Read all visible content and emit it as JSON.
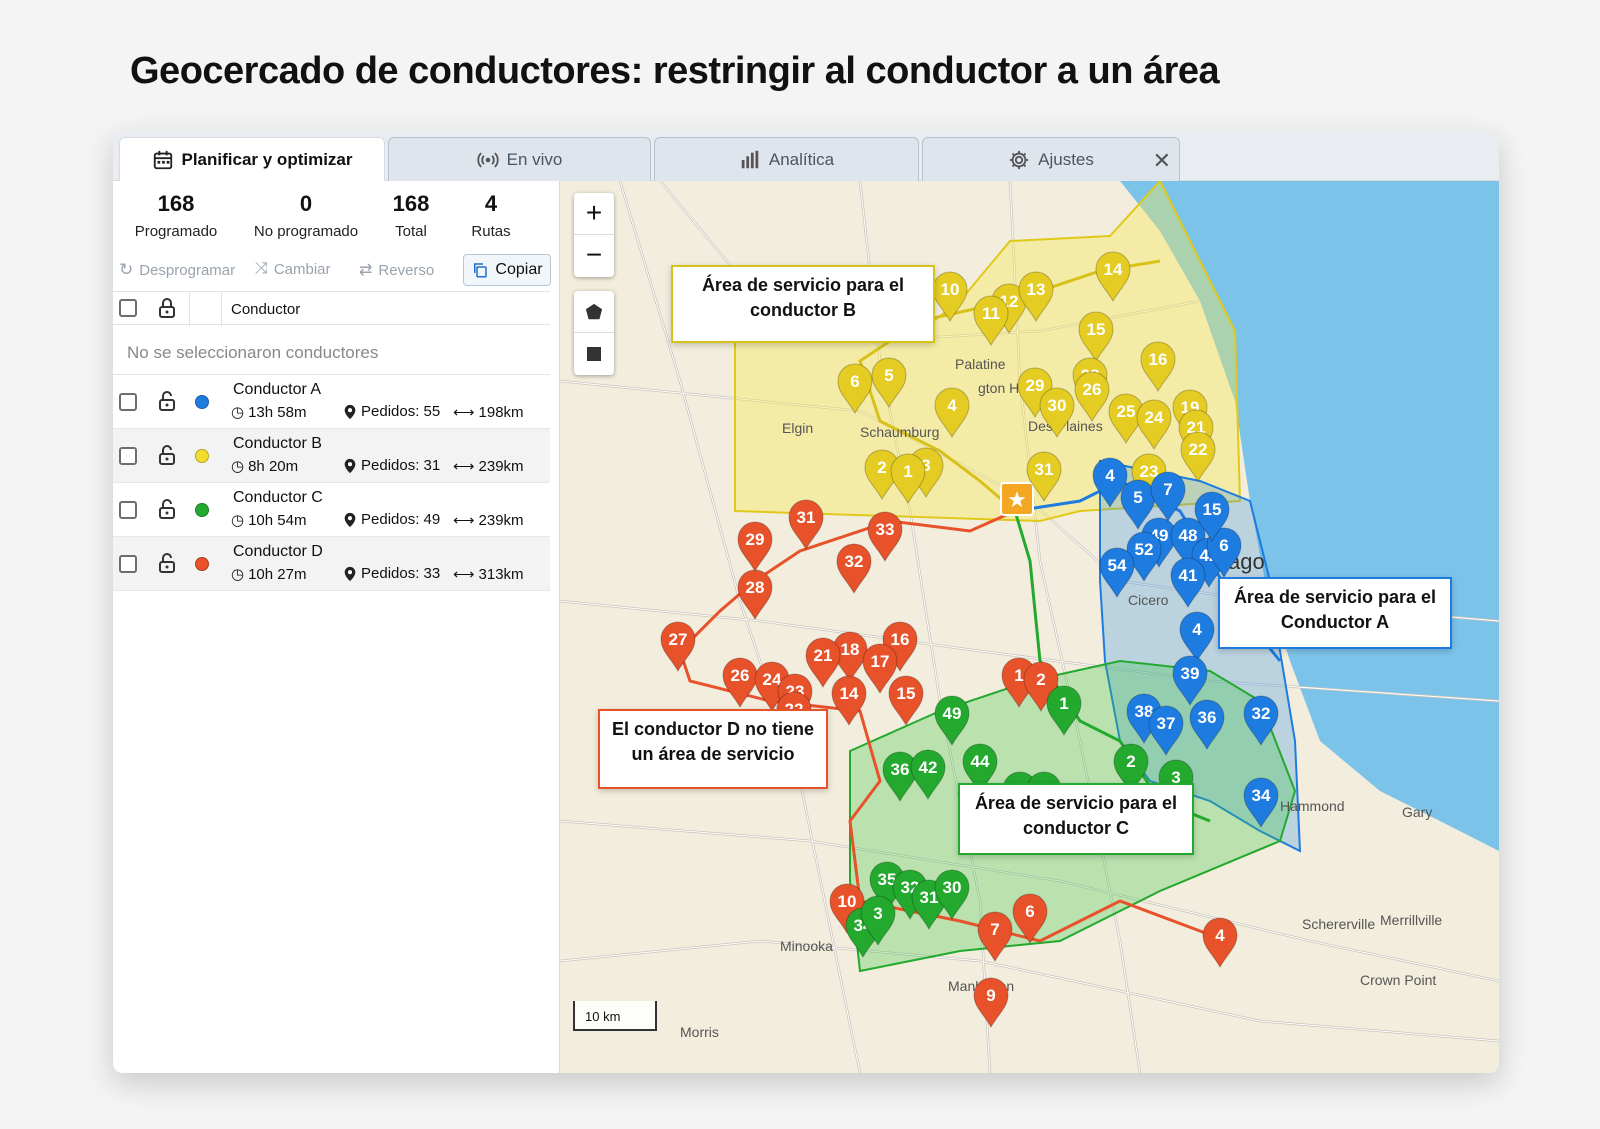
{
  "page_title": "Geocercado de conductores: restringir al conductor a un área",
  "tabs": [
    {
      "label": "Planificar y optimizar",
      "icon": "calendar-icon",
      "active": true
    },
    {
      "label": "En vivo",
      "icon": "broadcast-icon",
      "active": false
    },
    {
      "label": "Analítica",
      "icon": "bar-chart-icon",
      "active": false
    },
    {
      "label": "Ajustes",
      "icon": "gear-icon",
      "active": false
    }
  ],
  "stats": [
    {
      "value": "168",
      "label": "Programado"
    },
    {
      "value": "0",
      "label": "No programado"
    },
    {
      "value": "168",
      "label": "Total"
    },
    {
      "value": "4",
      "label": "Rutas"
    }
  ],
  "actions": {
    "unschedule": "Desprogramar",
    "swap": "Cambiar",
    "reverse": "Reverso",
    "copy": "Copiar"
  },
  "table": {
    "header_driver": "Conductor",
    "empty_selection": "No se seleccionaron conductores"
  },
  "drivers": [
    {
      "name": "Conductor A",
      "time": "13h 58m",
      "orders": "Pedidos: 55",
      "distance": "198km",
      "color": "#1e7ce0"
    },
    {
      "name": "Conductor B",
      "time": "8h 20m",
      "orders": "Pedidos: 31",
      "distance": "239km",
      "color": "#f2dc2e"
    },
    {
      "name": "Conductor C",
      "time": "10h 54m",
      "orders": "Pedidos: 49",
      "distance": "239km",
      "color": "#22a92e"
    },
    {
      "name": "Conductor D",
      "time": "10h 27m",
      "orders": "Pedidos: 33",
      "distance": "313km",
      "color": "#e8522a"
    }
  ],
  "map": {
    "zoom_in": "+",
    "zoom_out": "−",
    "scale": "10 km",
    "places": [
      {
        "name": "Palatine"
      },
      {
        "name": "Elgin"
      },
      {
        "name": "Schaumburg"
      },
      {
        "name": "Des Plaines"
      },
      {
        "name": "Cicero"
      },
      {
        "name": "Hammond"
      },
      {
        "name": "Gary"
      },
      {
        "name": "Schererville"
      },
      {
        "name": "Merrillville"
      },
      {
        "name": "Crown Point"
      },
      {
        "name": "Minooka"
      },
      {
        "name": "Manhattan"
      },
      {
        "name": "Morris"
      },
      {
        "name": "ago"
      },
      {
        "name": "gton Hei"
      }
    ],
    "callouts": {
      "b": "Área de servicio para el conductor B",
      "a": "Área de servicio para el Conductor A",
      "c": "Área de servicio para el conductor C",
      "d": "El conductor D no tiene un área de servicio"
    },
    "colors": {
      "a": "#1e7ce0",
      "b": "#f2dc2e",
      "c": "#22a92e",
      "d": "#e8522a",
      "water": "#7cc3ea",
      "land": "#f2eddd"
    },
    "pins_b": [
      "14",
      "10",
      "12",
      "13",
      "11",
      "15",
      "16",
      "6",
      "5",
      "29",
      "28",
      "26",
      "4",
      "30",
      "25",
      "24",
      "19",
      "21",
      "22",
      "23",
      "31",
      "3",
      "2",
      "1"
    ],
    "pins_d": [
      "31",
      "33",
      "29",
      "32",
      "28",
      "27",
      "16",
      "18",
      "21",
      "17",
      "26",
      "24",
      "23",
      "14",
      "15",
      "22",
      "1",
      "2",
      "10",
      "7",
      "6",
      "9",
      "4"
    ],
    "pins_a": [
      "4",
      "5",
      "7",
      "49",
      "48",
      "52",
      "54",
      "42",
      "6",
      "15",
      "41",
      "4",
      "39",
      "38",
      "37",
      "36",
      "32",
      "34"
    ],
    "pins_c": [
      "1",
      "49",
      "2",
      "3",
      "36",
      "42",
      "44",
      "13",
      "0",
      "35",
      "32",
      "31",
      "30",
      "34",
      "3"
    ]
  }
}
